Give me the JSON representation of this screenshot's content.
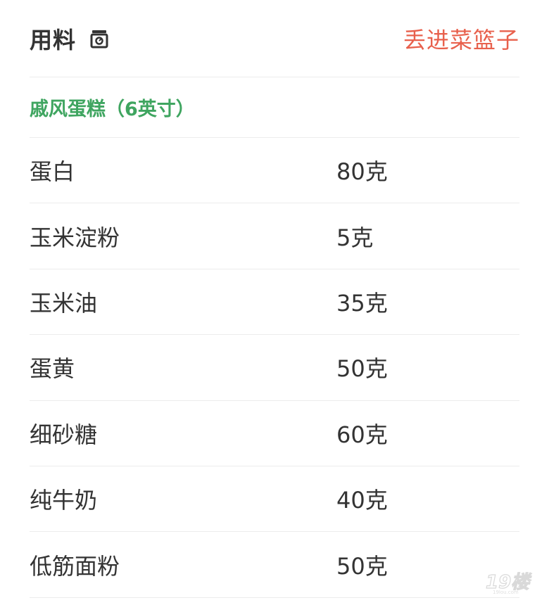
{
  "header": {
    "title": "用料",
    "title_icon": "kitchen-scale-icon",
    "basket_label": "丢进菜篮子"
  },
  "section": {
    "title": "戚风蛋糕（6英寸）"
  },
  "ingredients": [
    {
      "name": "蛋白",
      "amount": "80克"
    },
    {
      "name": "玉米淀粉",
      "amount": "5克"
    },
    {
      "name": "玉米油",
      "amount": "35克"
    },
    {
      "name": "蛋黄",
      "amount": "50克"
    },
    {
      "name": "细砂糖",
      "amount": "60克"
    },
    {
      "name": "纯牛奶",
      "amount": "40克"
    },
    {
      "name": "低筋面粉",
      "amount": "50克"
    }
  ],
  "watermark": {
    "text": "19楼"
  },
  "colors": {
    "accent_red": "#e8604c",
    "section_green": "#3fa560",
    "text": "#333333",
    "divider": "#ececec"
  }
}
